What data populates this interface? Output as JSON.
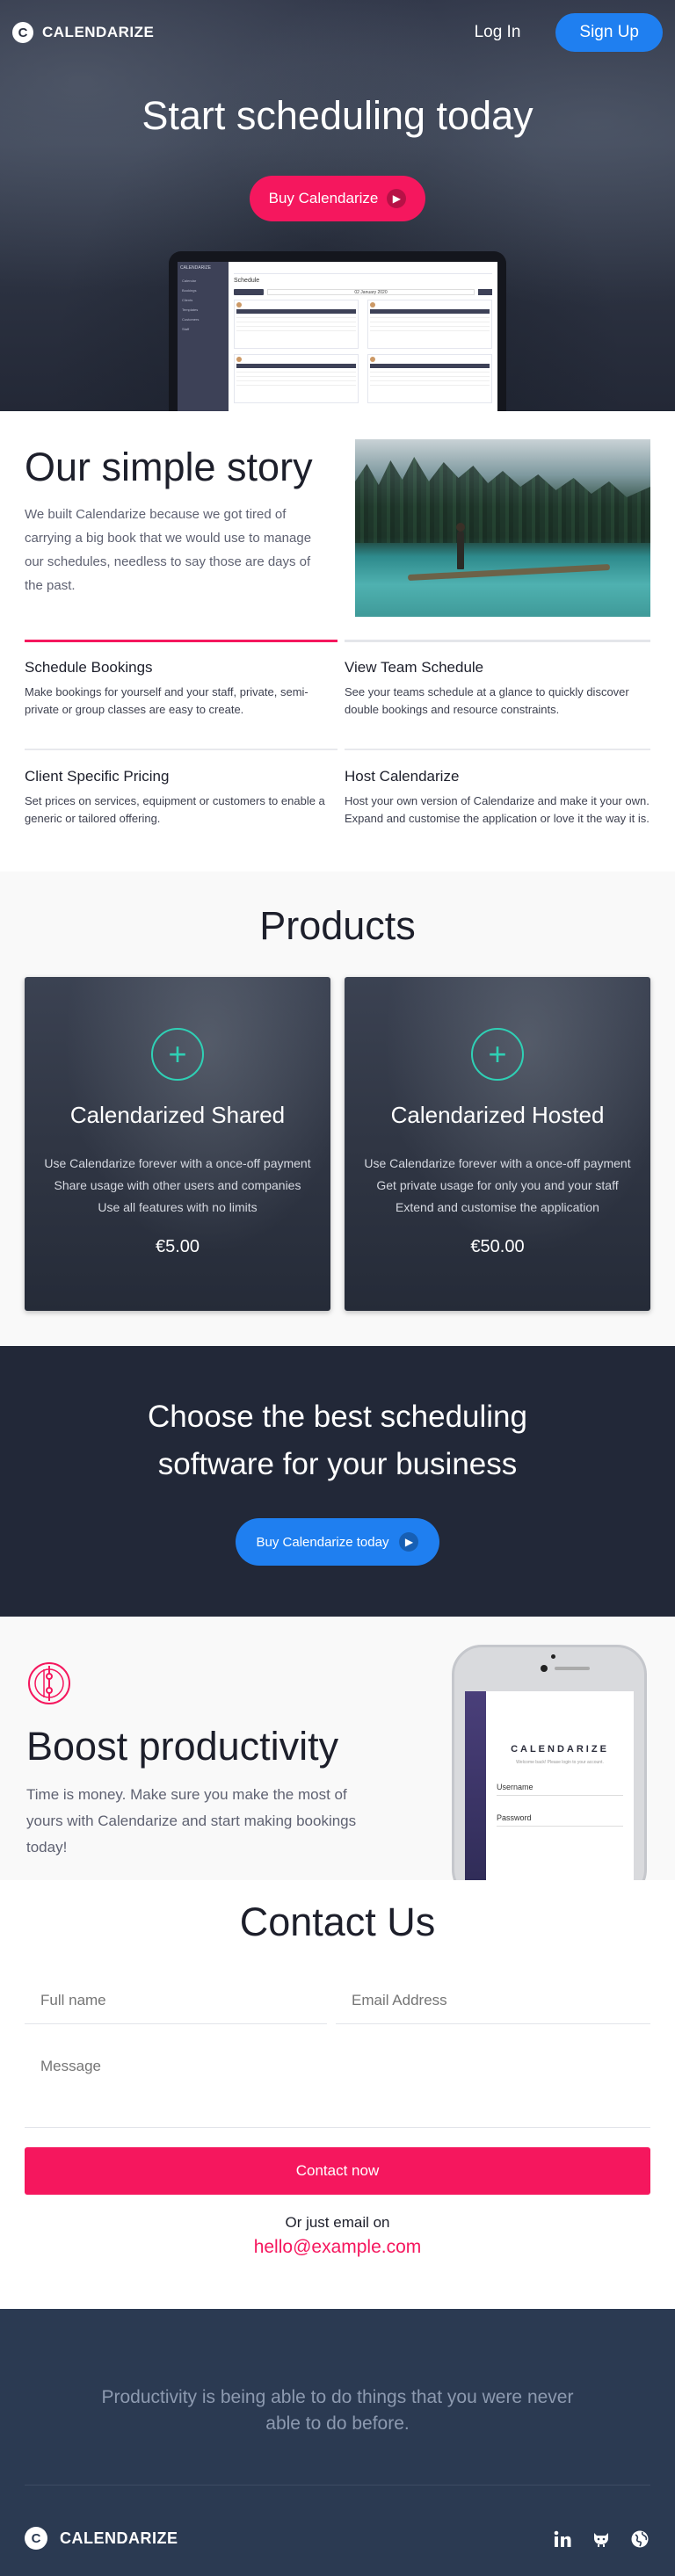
{
  "nav": {
    "brand": "CALENDARIZE",
    "brand_icon": "calendarize-logo-icon",
    "login": "Log In",
    "signup": "Sign Up"
  },
  "hero": {
    "title": "Start scheduling today",
    "cta": "Buy Calendarize",
    "app_preview": {
      "sidebar_title": "CALENDARIZE",
      "sidebar_items": [
        "Calendar",
        "Bookings",
        "Clients",
        "Templates",
        "Customers",
        "Staff"
      ],
      "heading": "Schedule",
      "date": "02 January 2020"
    }
  },
  "story": {
    "title": "Our simple story",
    "text": "We built Calendarize because we got tired of carrying a big book that we would use to manage our schedules, needless to say those are days of the past.",
    "features": [
      {
        "title": "Schedule Bookings",
        "text": "Make bookings for yourself and your staff, private, semi-private or group classes are easy to create."
      },
      {
        "title": "View Team Schedule",
        "text": "See your teams schedule at a glance to quickly discover double bookings and resource constraints."
      },
      {
        "title": "Client Specific Pricing",
        "text": "Set prices on services, equipment or customers to enable a generic or tailored offering."
      },
      {
        "title": "Host Calendarize",
        "text": "Host your own version of Calendarize and make it your own. Expand and customise the application or love it the way it is."
      }
    ]
  },
  "products": {
    "title": "Products",
    "items": [
      {
        "name": "Calendarized Shared",
        "features": [
          "Use Calendarize forever with a once-off payment",
          "Share usage with other users and companies",
          "Use all features with no limits"
        ],
        "price": "€5.00"
      },
      {
        "name": "Calendarized Hosted",
        "features": [
          "Use Calendarize forever with a once-off payment",
          "Get private usage for only you and your staff",
          "Extend and customise the application"
        ],
        "price": "€50.00"
      }
    ]
  },
  "choose": {
    "line1": "Choose the best scheduling",
    "line2": "software for your business",
    "cta": "Buy Calendarize today"
  },
  "boost": {
    "title": "Boost productivity",
    "text": "Time is money. Make sure you make the most of yours with Calendarize and start making bookings today!",
    "phone": {
      "brand": "CALENDARIZE",
      "subtitle": "Welcome back! Please login to your account.",
      "username": "Username",
      "password": "Password"
    }
  },
  "contact": {
    "title": "Contact Us",
    "full_name_placeholder": "Full name",
    "email_placeholder": "Email Address",
    "message_placeholder": "Message",
    "button": "Contact now",
    "or_text": "Or just email on",
    "email": "hello@example.com"
  },
  "footer": {
    "quote": "Productivity is being able to do things that you were never able to do before.",
    "brand": "CALENDARIZE",
    "social": [
      "linkedin-icon",
      "github-icon",
      "globe-icon"
    ]
  },
  "colors": {
    "accent_pink": "#f5175e",
    "accent_blue": "#1f7ff0",
    "teal": "#2fd0b5",
    "dark": "#222838"
  }
}
